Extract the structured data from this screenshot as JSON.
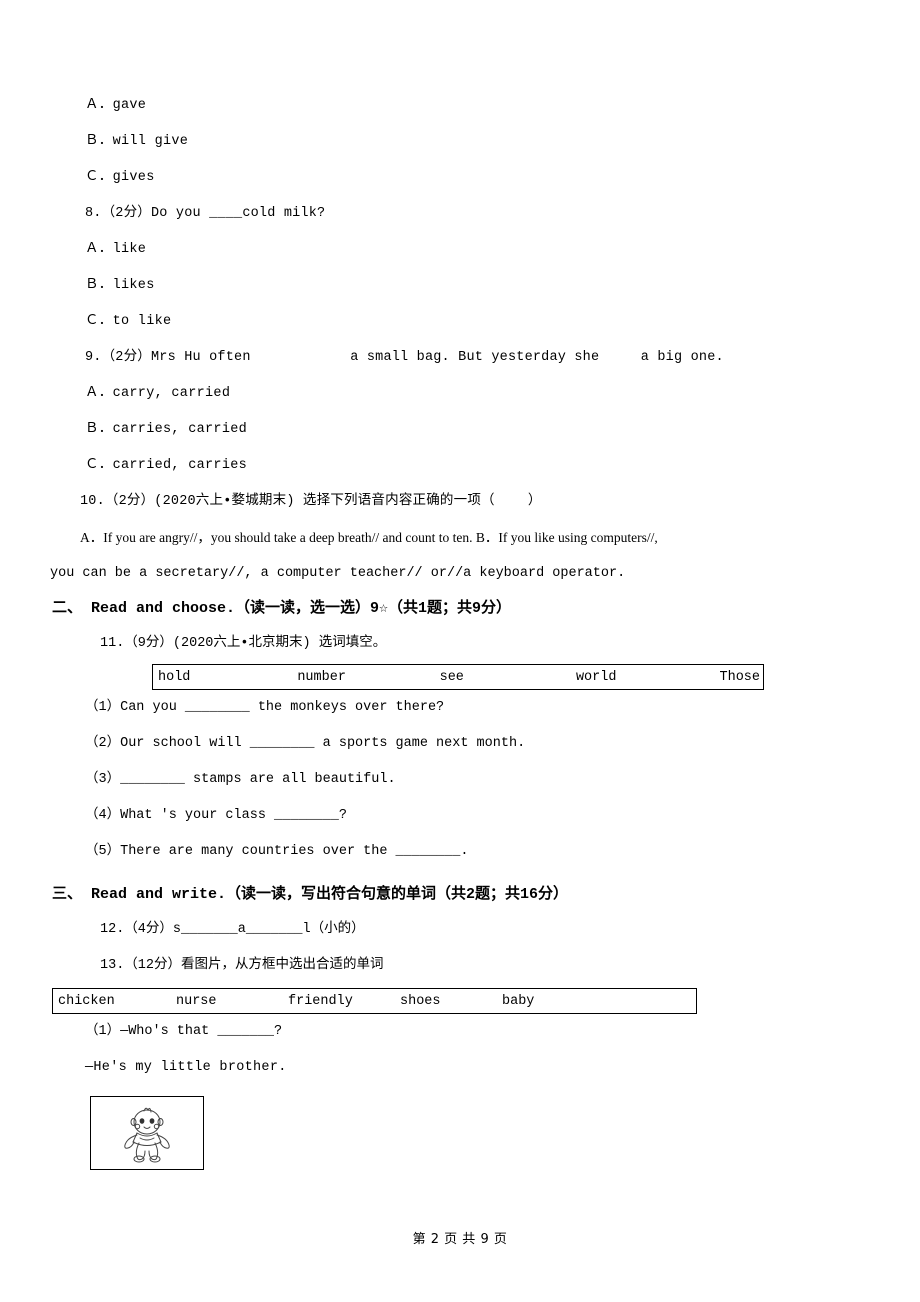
{
  "page": {
    "footer": "第 2 页 共 9 页"
  },
  "questions": [
    {
      "name": "q7-option-a",
      "text": "Ａ．gave"
    },
    {
      "name": "q7-option-b",
      "text": "Ｂ．will give"
    },
    {
      "name": "q7-option-c",
      "text": "Ｃ．gives"
    }
  ],
  "q8": {
    "stem": "8.（2分）Do you ____cold milk?",
    "options": [
      "Ａ．like",
      "Ｂ．likes",
      "Ｃ．to like"
    ]
  },
  "q9": {
    "stem": "9.（2分）Mrs Hu often            a small bag. But yesterday she     a big one.",
    "options": [
      "Ａ．carry, carried",
      "Ｂ．carries, carried",
      "Ｃ．carried, carries"
    ]
  },
  "q10": {
    "stem": "10.（2分）(2020六上•婺城期末) 选择下列语音内容正确的一项（    ）",
    "body_line1": "A．If you are angry//，you should take a deep breath// and count to ten. B．If you like using computers//,",
    "body_line2": "you can be a secretary//, a computer teacher// or//a keyboard operator."
  },
  "section2": {
    "title": "二、 Read and choose.（读一读，选一选）9☆（共1题；共9分）",
    "q11_stem": "11.（9分）(2020六上•北京期末) 选词填空。",
    "wordbank": [
      "hold",
      "number",
      "see",
      "world",
      "Those"
    ],
    "items": [
      "（1）Can you ________ the monkeys over there?",
      "（2）Our school will ________ a sports game next month.",
      "（3）________ stamps are all beautiful.",
      "（4）What 's your class ________?",
      "（5）There are many countries over the ________."
    ]
  },
  "section3": {
    "title": "三、 Read and write.（读一读，写出符合句意的单词（共2题；共16分）",
    "q12_stem": "12.（4分）s_______a_______l（小的）",
    "q13_stem": "13.（12分）看图片，从方框中选出合适的单词",
    "wordbank": [
      "chicken",
      "nurse",
      "friendly",
      "shoes",
      "baby"
    ],
    "item1": "（1）—Who's that _______?",
    "item1_answer": "—He's my little brother.",
    "image_alt": "baby-illustration"
  }
}
